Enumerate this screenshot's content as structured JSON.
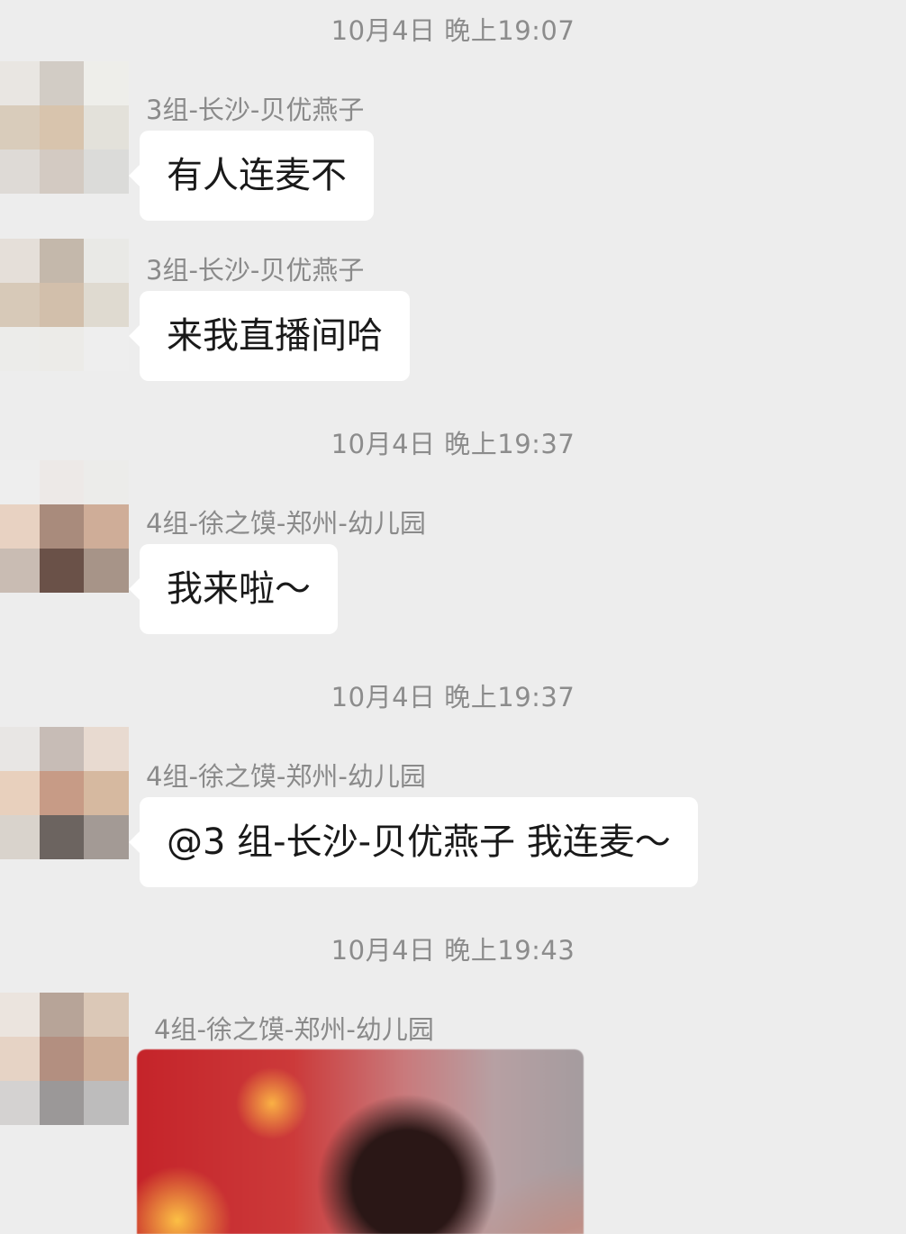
{
  "messages": [
    {
      "timestamp": "10月4日 晚上19:07",
      "sender": "3组-长沙-贝优燕子",
      "text": "有人连麦不"
    },
    {
      "sender": "3组-长沙-贝优燕子",
      "text": "来我直播间哈"
    },
    {
      "timestamp": "10月4日 晚上19:37",
      "sender": "4组-徐之馍-郑州-幼儿园",
      "text": "我来啦～"
    },
    {
      "timestamp": "10月4日 晚上19:37",
      "sender": "4组-徐之馍-郑州-幼儿园",
      "text": "@3 组-长沙-贝优燕子  我连麦～"
    },
    {
      "timestamp": "10月4日 晚上19:43",
      "sender": "4组-徐之馍-郑州-幼儿园"
    }
  ],
  "colors": {
    "background": "#ededed",
    "bubble": "#ffffff",
    "meta_text": "#8a8a8a",
    "message_text": "#191919"
  },
  "avatars": [
    {
      "pixels": [
        "#e9e6e2",
        "#d2ccc5",
        "#eeeeea",
        "#d9ccbb",
        "#d8c4ad",
        "#e3e1da",
        "#dedad6",
        "#d3cac2",
        "#dbdbd9"
      ]
    },
    {
      "pixels": [
        "#e5dfd9",
        "#c4b8ab",
        "#e9e9e6",
        "#d7c9b8",
        "#d2bfab",
        "#dfdad0",
        "#ececea",
        "#ecebe8",
        "#eeeeee"
      ]
    },
    {
      "pixels": [
        "#eeeeee",
        "#ede9e7",
        "#ececea",
        "#e8d2c2",
        "#a98b7c",
        "#cfad98",
        "#c9bcb3",
        "#6a5148",
        "#a79488"
      ]
    },
    {
      "pixels": [
        "#e8e6e4",
        "#c7bcb6",
        "#e8dad0",
        "#e8d0bd",
        "#c79b86",
        "#d6b9a0",
        "#d9d3cc",
        "#6c6460",
        "#a39a95"
      ]
    },
    {
      "pixels": [
        "#ebe4de",
        "#b7a498",
        "#dbc8b7",
        "#e6d3c5",
        "#b38f80",
        "#ceae98",
        "#d4d2d1",
        "#9b9898",
        "#bdbcbc"
      ]
    }
  ]
}
